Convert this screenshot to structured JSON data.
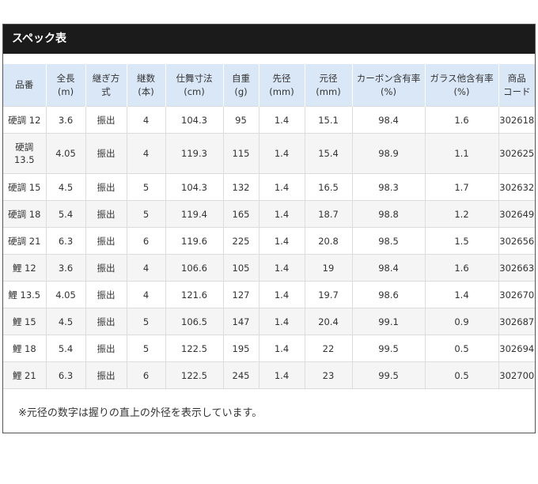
{
  "spec": {
    "title": "スペック表",
    "headers": [
      [
        "品番"
      ],
      [
        "全長",
        "(m)"
      ],
      [
        "継ぎ方",
        "式"
      ],
      [
        "継数",
        "(本)"
      ],
      [
        "仕舞寸法",
        "(cm)"
      ],
      [
        "自重",
        "(g)"
      ],
      [
        "先径",
        "(mm)"
      ],
      [
        "元径",
        "(mm)"
      ],
      [
        "カーボン含有率",
        "(%)"
      ],
      [
        "ガラス他含有率",
        "(%)"
      ],
      [
        "商品",
        "コード"
      ]
    ],
    "rows": [
      [
        "硬調 12",
        "3.6",
        "振出",
        "4",
        "104.3",
        "95",
        "1.4",
        "15.1",
        "98.4",
        "1.6",
        "302618"
      ],
      [
        "硬調 13.5",
        "4.05",
        "振出",
        "4",
        "119.3",
        "115",
        "1.4",
        "15.4",
        "98.9",
        "1.1",
        "302625"
      ],
      [
        "硬調 15",
        "4.5",
        "振出",
        "5",
        "104.3",
        "132",
        "1.4",
        "16.5",
        "98.3",
        "1.7",
        "302632"
      ],
      [
        "硬調 18",
        "5.4",
        "振出",
        "5",
        "119.4",
        "165",
        "1.4",
        "18.7",
        "98.8",
        "1.2",
        "302649"
      ],
      [
        "硬調 21",
        "6.3",
        "振出",
        "6",
        "119.6",
        "225",
        "1.4",
        "20.8",
        "98.5",
        "1.5",
        "302656"
      ],
      [
        "鯉 12",
        "3.6",
        "振出",
        "4",
        "106.6",
        "105",
        "1.4",
        "19",
        "98.4",
        "1.6",
        "302663"
      ],
      [
        "鯉 13.5",
        "4.05",
        "振出",
        "4",
        "121.6",
        "127",
        "1.4",
        "19.7",
        "98.6",
        "1.4",
        "302670"
      ],
      [
        "鯉 15",
        "4.5",
        "振出",
        "5",
        "106.5",
        "147",
        "1.4",
        "20.4",
        "99.1",
        "0.9",
        "302687"
      ],
      [
        "鯉 18",
        "5.4",
        "振出",
        "5",
        "122.5",
        "195",
        "1.4",
        "22",
        "99.5",
        "0.5",
        "302694"
      ],
      [
        "鯉 21",
        "6.3",
        "振出",
        "6",
        "122.5",
        "245",
        "1.4",
        "23",
        "99.5",
        "0.5",
        "302700"
      ]
    ],
    "note": "※元径の数字は握りの直上の外径を表示しています。"
  }
}
